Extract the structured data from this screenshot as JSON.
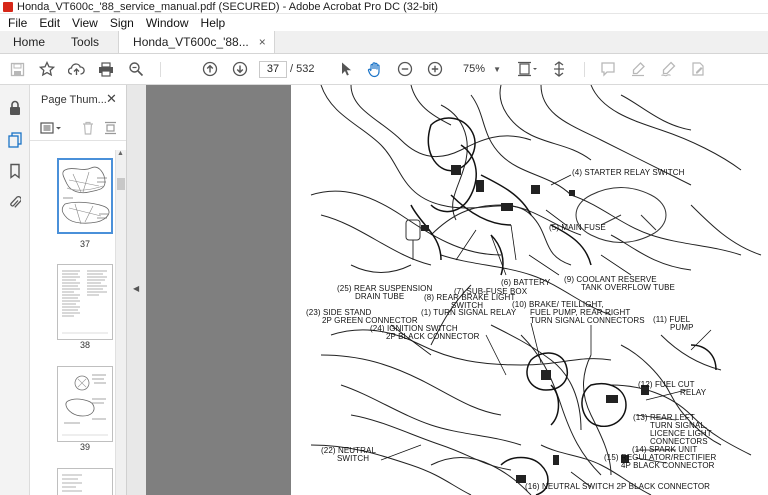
{
  "window": {
    "title": "Honda_VT600c_'88_service_manual.pdf (SECURED) - Adobe Acrobat Pro DC (32-bit)"
  },
  "menu": {
    "items": [
      "File",
      "Edit",
      "View",
      "Sign",
      "Window",
      "Help"
    ]
  },
  "tabs": {
    "home": "Home",
    "tools": "Tools",
    "document": "Honda_VT600c_'88...",
    "close_glyph": "×"
  },
  "toolbar": {
    "current_page": "37",
    "page_total": "/ 532",
    "zoom": "75%"
  },
  "thumbnail_panel": {
    "title": "Page Thum...",
    "close_glyph": "✕",
    "thumbnails": [
      {
        "label": "37",
        "selected": true
      },
      {
        "label": "38",
        "selected": false
      },
      {
        "label": "39",
        "selected": false
      }
    ]
  },
  "document_page": {
    "callouts": {
      "c4": "(4) STARTER RELAY SWITCH",
      "c5": "(5) MAIN FUSE",
      "c25a": "(25) REAR SUSPENSION",
      "c25b": "DRAIN TUBE",
      "c6": "(6) BATTERY",
      "c7": "(7) SUB-FUSE BOX",
      "c9a": "(9) COOLANT RESERVE",
      "c9b": "TANK OVERFLOW TUBE",
      "c8a": "(8) REAR BRAKE LIGHT",
      "c8b": "SWITCH",
      "c10a": "(10) BRAKE/ TEILLIGHT,",
      "c10b": "FUEL PUMP, REAR RIGHT",
      "c10c": "TURN SIGNAL CONNECTORS",
      "c23a": "(23) SIDE STAND",
      "c23b": "2P GREEN CONNECTOR",
      "c1": "(1) TURN SIGNAL RELAY",
      "c11a": "(11) FUEL",
      "c11b": "PUMP",
      "c24a": "(24) IGNITION SWITCH",
      "c24b": "2P BLACK CONNECTOR",
      "c12a": "(12) FUEL CUT",
      "c12b": "RELAY",
      "c13a": "(13) REAR LEFT",
      "c13b": "TURN SIGNAL,",
      "c13c": "LICENCE LIGHT",
      "c13d": "CONNECTORS",
      "c14": "(14) SPARK UNIT",
      "c15a": "(15) REGULATOR/RECTIFIER",
      "c15b": "4P BLACK CONNECTOR",
      "c22a": "(22) NEUTRAL",
      "c22b": "SWITCH",
      "c16": "(16) NEUTRAL SWITCH 2P BLACK CONNECTOR"
    }
  },
  "colors": {
    "accent": "#1a73c7",
    "viewport_bg": "#7f7f7f",
    "title_icon": "#d62718"
  }
}
